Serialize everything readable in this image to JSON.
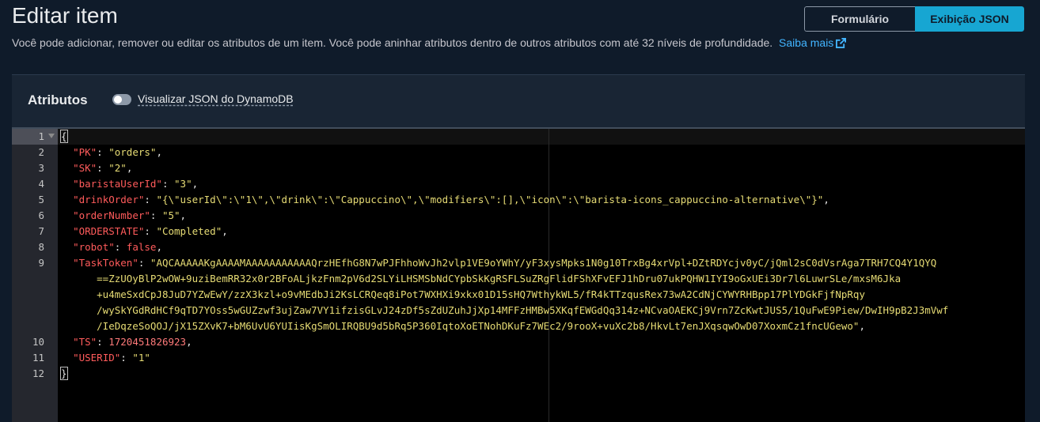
{
  "header": {
    "title": "Editar item",
    "description": "Você pode adicionar, remover ou editar os atributos de um item. Você pode aninhar atributos dentro de outros atributos com até 32 níveis de profundidade.",
    "learn_more": "Saiba mais"
  },
  "view_toggle": {
    "form_label": "Formulário",
    "json_label": "Exibição JSON",
    "selected": "Exibição JSON"
  },
  "panel": {
    "title": "Atributos",
    "toggle_label": "Visualizar JSON do DynamoDB",
    "toggle_on": false
  },
  "editor": {
    "line_numbers": [
      "1",
      "2",
      "3",
      "4",
      "5",
      "6",
      "7",
      "8",
      "9",
      "",
      "",
      "",
      "",
      "10",
      "11",
      "12"
    ],
    "lines": {
      "l1": "{",
      "l2_key": "\"PK\"",
      "l2_val": "\"orders\"",
      "l3_key": "\"SK\"",
      "l3_val": "\"2\"",
      "l4_key": "\"baristaUserId\"",
      "l4_val": "\"3\"",
      "l5_key": "\"drinkOrder\"",
      "l5_val": "\"{\\\"userId\\\":\\\"1\\\",\\\"drink\\\":\\\"Cappuccino\\\",\\\"modifiers\\\":[],\\\"icon\\\":\\\"barista-icons_cappuccino-alternative\\\"}\"",
      "l6_key": "\"orderNumber\"",
      "l6_val": "\"5\"",
      "l7_key": "\"ORDERSTATE\"",
      "l7_val": "\"Completed\"",
      "l8_key": "\"robot\"",
      "l8_val": "false",
      "l9_key": "\"TaskToken\"",
      "l9_val_1": "\"AQCAAAAAKgAAAAMAAAAAAAAAAAQrzHEfhG8N7wPJFhhoWvJh2vlp1VE9oYWhY/yF3xysMpks1N0g10TrxBg4xrVpl+DZtRDYcjv0yC/jQml2sC0dVsrAga7TRH7CQ4Y1QYQ",
      "l9_val_2": "==ZzUOyBlP2wOW+9uziBemRR32x0r2BFoALjkzFnm2pV6d2SLYiLHSMSbNdCYpbSkKgRSFLSuZRgFlidFShXFvEFJ1hDru07ukPQHW1IYI9oGxUEi3Dr7l6LuwrSLe/mxsM6Jka",
      "l9_val_3": "+u4meSxdCpJ8JuD7YZwEwY/zzX3kzl+o9vMEdbJi2KsLCRQeq8iPot7WXHXi9xkx01D15sHQ7WthykWL5/fR4kTTzqusRex73wA2CdNjCYWYRHBpp17PlYDGkFjfNpRqy",
      "l9_val_4": "/wySkYGdRdHCf9qTD7YOss5wGUZzwf3ujZaw7VY1ifzisGLvJ24zDf5sZdUZuhJjXp14MFFzHMBw5XKqfEWGdQq314z+NCvaOAEKCj9Vrn7ZcKwtJUS5/1QuFwE9Piew/DwIH9pB2J3mVwf",
      "l9_val_5": "/IeDqzeSoQOJ/jX15ZXvK7+bM6UvU6YUIisKgSmOLIRQBU9d5bRq5P360IqtoXoETNohDKuFz7WEc2/9rooX+vuXc2b8/HkvLt7enJXqsqwOwD07XoxmCz1fncUGewo\"",
      "l10_key": "\"TS\"",
      "l10_val": "1720451826923",
      "l11_key": "\"USERID\"",
      "l11_val": "\"1\"",
      "l12": "}"
    }
  }
}
